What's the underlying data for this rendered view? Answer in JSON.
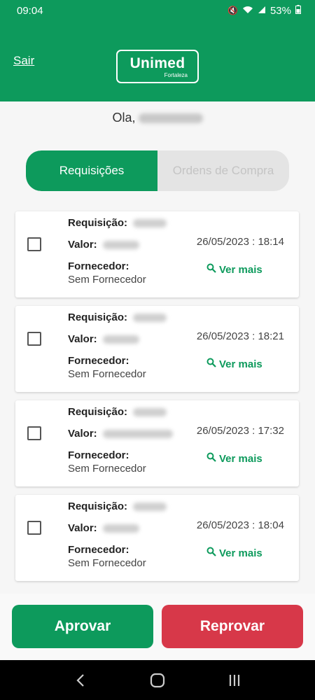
{
  "status_bar": {
    "time": "09:04",
    "battery": "53%"
  },
  "header": {
    "logout_label": "Sair",
    "brand": "Unimed",
    "brand_sub": "Fortaleza"
  },
  "greeting": {
    "prefix": "Ola,"
  },
  "tabs": [
    {
      "label": "Requisições",
      "active": true
    },
    {
      "label": "Ordens de Compra",
      "active": false
    }
  ],
  "fields": {
    "requisicao_label": "Requisição:",
    "valor_label": "Valor:",
    "fornecedor_label": "Fornecedor:",
    "ver_mais_label": "Ver mais"
  },
  "requests": [
    {
      "datetime": "26/05/2023 : 18:14",
      "fornecedor": "Sem Fornecedor"
    },
    {
      "datetime": "26/05/2023 : 18:21",
      "fornecedor": "Sem Fornecedor"
    },
    {
      "datetime": "26/05/2023 : 17:32",
      "fornecedor": "Sem Fornecedor"
    },
    {
      "datetime": "26/05/2023 : 18:04",
      "fornecedor": "Sem Fornecedor"
    }
  ],
  "actions": {
    "approve_label": "Aprovar",
    "reject_label": "Reprovar"
  },
  "colors": {
    "primary": "#0d9a5c",
    "danger": "#d73849"
  }
}
